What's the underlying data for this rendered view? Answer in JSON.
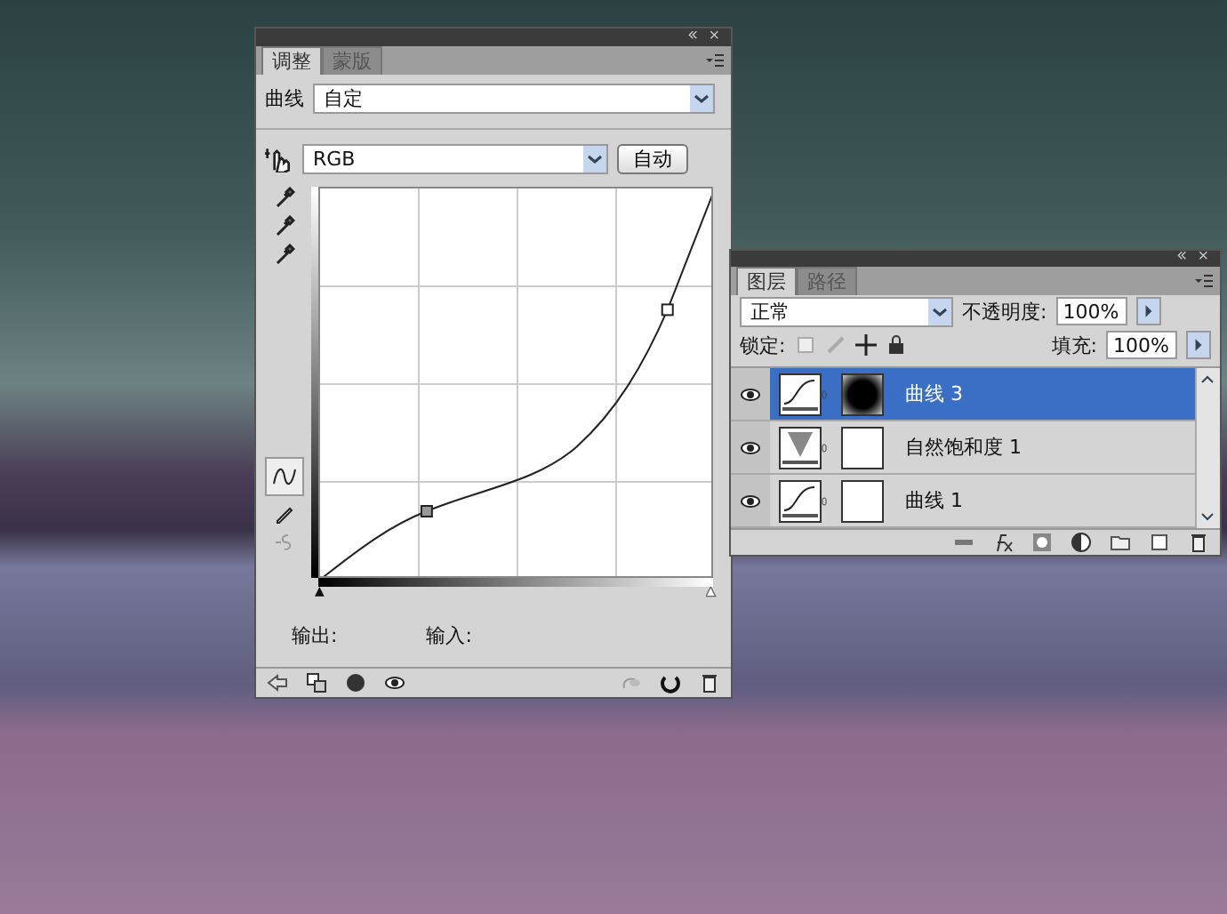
{
  "adjustments_panel": {
    "tabs": [
      {
        "label": "调整",
        "selected": true
      },
      {
        "label": "蒙版",
        "selected": false
      }
    ],
    "preset_label": "曲线",
    "preset_value": "自定",
    "channel": "RGB",
    "auto_button": "自动",
    "output_label": "输出:",
    "input_label": "输入:"
  },
  "layers_panel": {
    "tabs": [
      {
        "label": "图层",
        "selected": true
      },
      {
        "label": "路径",
        "selected": false
      }
    ],
    "blend_mode": "正常",
    "opacity_label": "不透明度:",
    "opacity_value": "100%",
    "lock_label": "锁定:",
    "fill_label": "填充:",
    "fill_value": "100%",
    "layers": [
      {
        "name": "曲线 3",
        "kind": "curves",
        "mask_filled": true,
        "selected": true,
        "visible": true
      },
      {
        "name": "自然饱和度 1",
        "kind": "vibrance",
        "mask_filled": false,
        "selected": false,
        "visible": true
      },
      {
        "name": "曲线 1",
        "kind": "curves",
        "mask_filled": false,
        "selected": false,
        "visible": true
      }
    ]
  }
}
